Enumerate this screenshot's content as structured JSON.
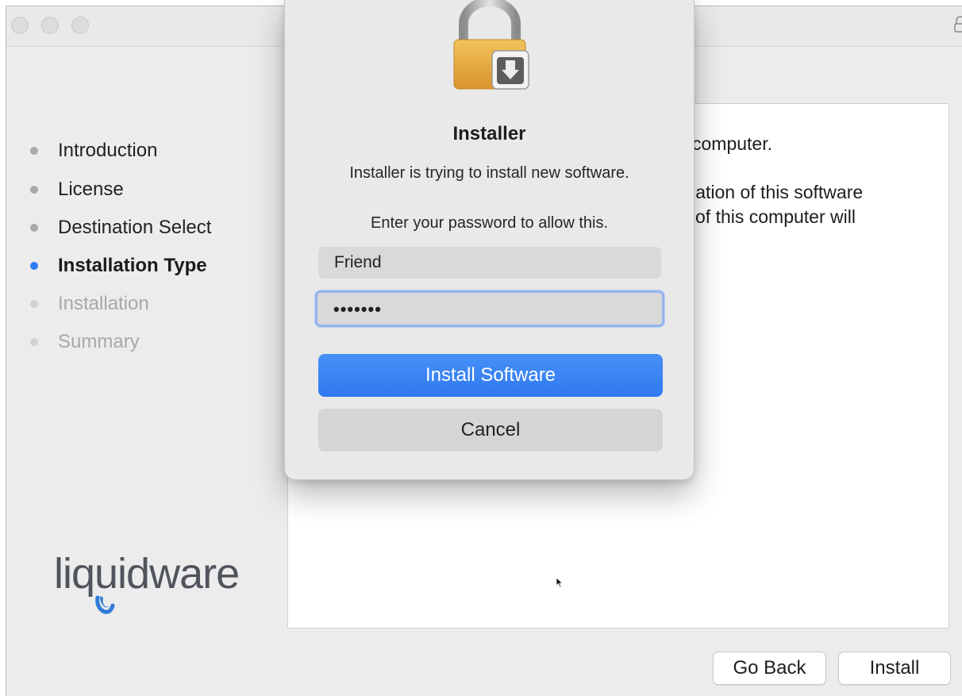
{
  "sidebar": {
    "steps": [
      {
        "label": "Introduction",
        "state": "done"
      },
      {
        "label": "License",
        "state": "done"
      },
      {
        "label": "Destination Select",
        "state": "done"
      },
      {
        "label": "Installation Type",
        "state": "current"
      },
      {
        "label": "Installation",
        "state": "pending"
      },
      {
        "label": "Summary",
        "state": "pending"
      }
    ],
    "logo_text": "liquidware"
  },
  "content": {
    "lines": [
      "computer.",
      "llation of this software",
      "of this computer will"
    ]
  },
  "footer": {
    "go_back_label": "Go Back",
    "install_label": "Install"
  },
  "dialog": {
    "icon": "padlock-installer-icon",
    "title": "Installer",
    "message": "Installer is trying to install new software.",
    "prompt": "Enter your password to allow this.",
    "username_value": "Friend",
    "password_value": "•••••••",
    "install_software_label": "Install Software",
    "cancel_label": "Cancel"
  },
  "colors": {
    "accent": "#3a86f5",
    "current_step_dot": "#2f7bf3",
    "logo_text": "#50555c",
    "logo_drop": "#2f7bd6"
  }
}
